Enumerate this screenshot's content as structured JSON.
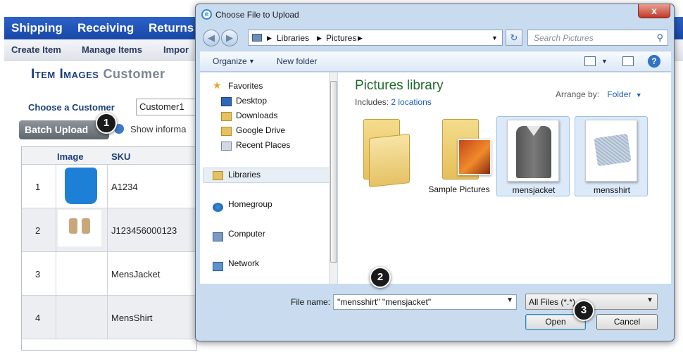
{
  "app": {
    "nav_primary": [
      "Shipping",
      "Receiving",
      "Returns"
    ],
    "nav_secondary": [
      "Create Item",
      "Manage Items",
      "Impor"
    ],
    "page_title": "Item Images",
    "page_subtitle": "Customer",
    "choose_customer_label": "Choose a Customer",
    "customer_value": "Customer1",
    "batch_upload_label": "Batch Upload",
    "show_info_label": "Show informa",
    "grid": {
      "headers": [
        "Image",
        "SKU"
      ],
      "rows": [
        {
          "num": "1",
          "sku": "A1234"
        },
        {
          "num": "2",
          "sku": "J123456000123"
        },
        {
          "num": "3",
          "sku": "MensJacket"
        },
        {
          "num": "4",
          "sku": "MensShirt"
        }
      ]
    }
  },
  "dialog": {
    "title": "Choose File to Upload",
    "close_label": "x",
    "address": [
      "Libraries",
      "Pictures"
    ],
    "search_placeholder": "Search Pictures",
    "toolbar": {
      "organize": "Organize",
      "new_folder": "New folder"
    },
    "nav_pane": {
      "favorites": "Favorites",
      "favorite_items": [
        "Desktop",
        "Downloads",
        "Google Drive",
        "Recent Places"
      ],
      "libraries": "Libraries",
      "homegroup": "Homegroup",
      "computer": "Computer",
      "network": "Network"
    },
    "library_title": "Pictures library",
    "includes_label": "Includes:",
    "includes_link": "2 locations",
    "arrange_label": "Arrange by:",
    "arrange_value": "Folder",
    "files": [
      {
        "label": "",
        "kind": "folder",
        "selected": false
      },
      {
        "label": "Sample Pictures",
        "kind": "folder-photo",
        "selected": false
      },
      {
        "label": "mensjacket",
        "kind": "image",
        "selected": true
      },
      {
        "label": "mensshirt",
        "kind": "image",
        "selected": true
      }
    ],
    "file_name_label": "File name:",
    "file_name_value": "\"mensshirt\" \"mensjacket\"",
    "file_type_value": "All Files (*.*)",
    "open_label": "Open",
    "cancel_label": "Cancel"
  },
  "badges": [
    "1",
    "2",
    "3"
  ]
}
